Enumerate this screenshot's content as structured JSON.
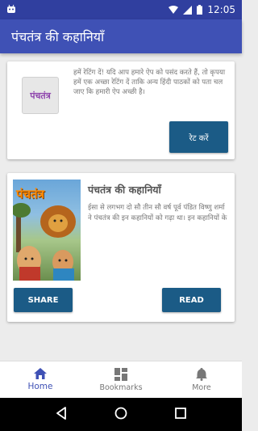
{
  "status_bar": {
    "time": "12:05"
  },
  "app_bar": {
    "title": "पंचतंत्र की कहानियाँ"
  },
  "rate_card": {
    "logo_text": "पंचतंत्र",
    "message": "हमें रेटिंग दें! यदि आप हमारे ऐप को पसंद करते हैं, तो कृपया हमें एक अच्छा रेटिंग दें ताकि अन्य हिंदी पाठकों को पता चल जाए कि हमारी ऐप अच्छी है।",
    "rate_button": "रेट करें"
  },
  "story_card": {
    "cover_text": "पंचतंत्र",
    "title": "पंचतंत्र की कहानियाँ",
    "description": "ईसा से लगभग दो सौ तीन सौ वर्ष पूर्व पंडित विष्णु शर्मा ने पंचतंत्र की इन कहानियों को गढ़ा था। इन कहानियों के",
    "share_button": "SHARE",
    "read_button": "READ"
  },
  "bottom_nav": {
    "items": [
      {
        "label": "Home",
        "icon": "home-icon",
        "active": true
      },
      {
        "label": "Bookmarks",
        "icon": "bookmarks-icon",
        "active": false
      },
      {
        "label": "More",
        "icon": "bell-icon",
        "active": false
      }
    ]
  },
  "colors": {
    "primary": "#3f51b5",
    "primary_dark": "#303f9f",
    "button": "#1b5b86"
  }
}
